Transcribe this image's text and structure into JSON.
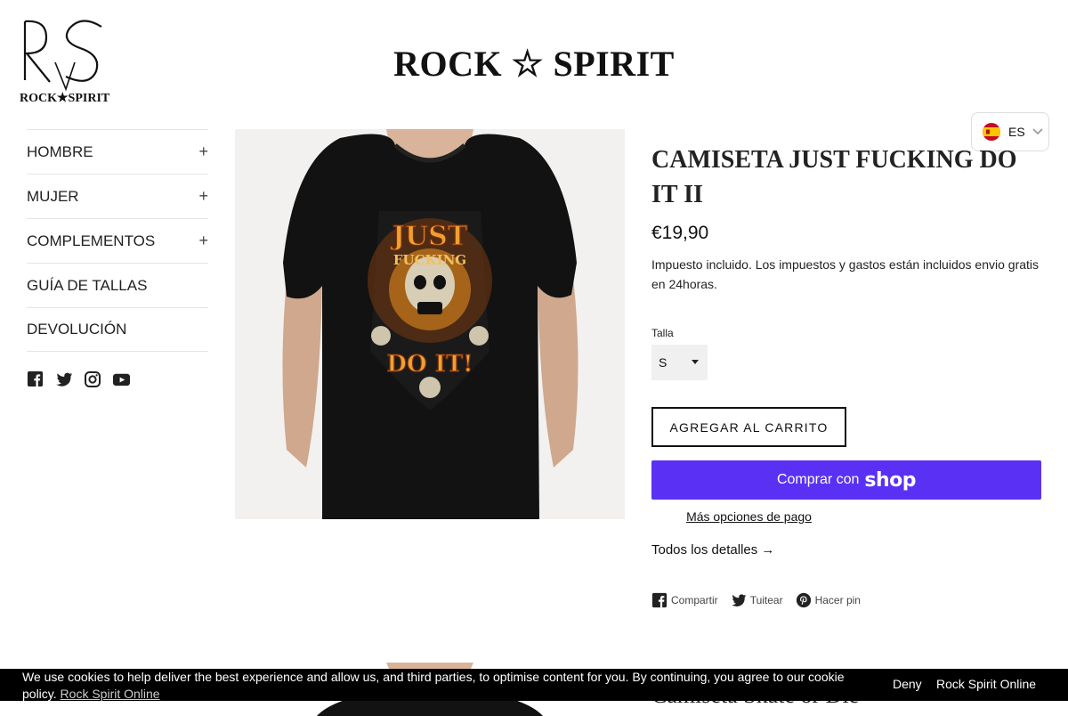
{
  "header": {
    "logo_text": "ROCK★SPIRIT",
    "site_title": "ROCK ☆ SPIRIT"
  },
  "sidebar": {
    "items": [
      {
        "label": "HOMBRE",
        "expand": "+"
      },
      {
        "label": "MUJER",
        "expand": "+"
      },
      {
        "label": "COMPLEMENTOS",
        "expand": "+"
      },
      {
        "label": "GUÍA DE TALLAS",
        "expand": ""
      },
      {
        "label": "DEVOLUCIÓN",
        "expand": ""
      }
    ],
    "social": [
      "facebook-icon",
      "twitter-icon",
      "instagram-icon",
      "youtube-icon"
    ]
  },
  "language": {
    "code": "ES",
    "flag": "spain-flag-icon"
  },
  "product": {
    "title": "CAMISETA JUST FUCKING DO IT II",
    "price": "€19,90",
    "tax_note": "Impuesto incluido. Los impuestos y gastos están incluidos envio gratis en 24horas.",
    "size_label": "Talla",
    "size_value": "S",
    "add_to_cart": "AGREGAR AL CARRITO",
    "shop_pay_prefix": "Comprar con",
    "shop_pay_brand": "shop",
    "more_payment": "Más opciones de pago",
    "details_link": "Todos los detalles →",
    "shirt_print": {
      "line1": "JUST",
      "line2": "FUCKING",
      "line3": "DO IT!"
    }
  },
  "share": {
    "facebook": "Compartir",
    "twitter": "Tuitear",
    "pinterest": "Hacer pin"
  },
  "next_product": {
    "title_partial": "Camiseta Skate or Die"
  },
  "cookie": {
    "text": "We use cookies to help deliver the best experience and allow us, and third parties, to optimise content for you. By continuing, you agree to our cookie policy.",
    "policy_link": "Rock Spirit Online",
    "deny": "Deny",
    "accept": "Rock Spirit Online"
  },
  "colors": {
    "shop_pay": "#5a31f4",
    "cookie_bg": "#000000",
    "image_bg": "#f2f1f0"
  }
}
